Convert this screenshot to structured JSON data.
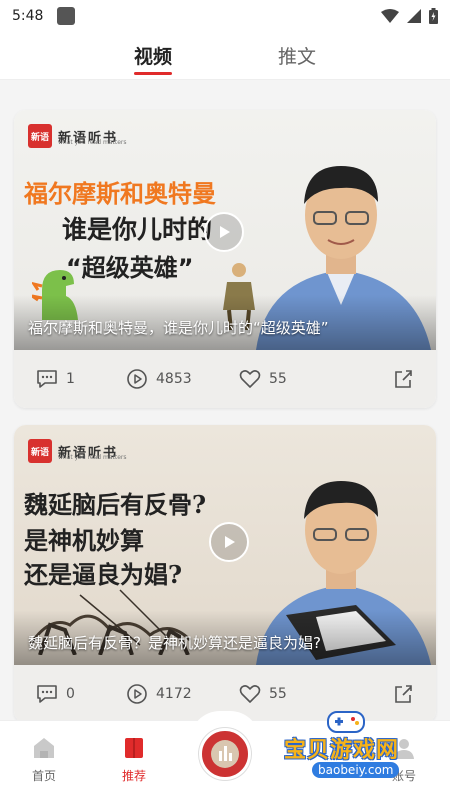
{
  "status_bar": {
    "time": "5:48"
  },
  "tabs": [
    {
      "label": "视频",
      "active": true
    },
    {
      "label": "推文",
      "active": false
    }
  ],
  "cards": [
    {
      "brand": {
        "logo_text": "新语",
        "name": "新语听书",
        "tagline": "what you read matters"
      },
      "headline": [
        "福尔摩斯和奥特曼",
        "谁是你儿时的",
        "“超级英雄”"
      ],
      "caption": "福尔摩斯和奥特曼，谁是你儿时的“超级英雄”",
      "comments": "1",
      "plays": "4853",
      "likes": "55"
    },
    {
      "brand": {
        "logo_text": "新语",
        "name": "新语听书",
        "tagline": "what you read matters"
      },
      "headline": [
        "魏延脑后有反骨?",
        "是神机妙算",
        "还是逼良为娼?"
      ],
      "caption": "魏延脑后有反骨？是神机妙算还是逼良为娼?",
      "comments": "0",
      "plays": "4172",
      "likes": "55"
    }
  ],
  "bottom_nav": {
    "home": "首页",
    "recommend": "推荐",
    "account": "账号"
  },
  "watermark": {
    "title": "宝贝游戏网",
    "url": "baobeiy.com"
  },
  "colors": {
    "accent": "#e02b2b",
    "brand_red": "#d8312e",
    "orange_headline": "#f07820"
  }
}
